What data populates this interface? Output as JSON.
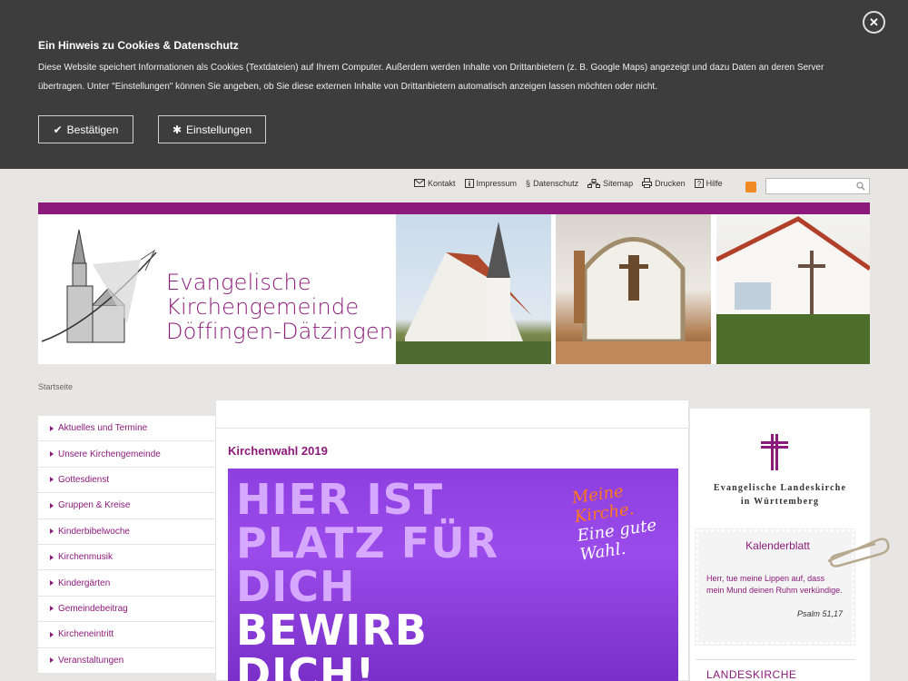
{
  "cookie": {
    "title": "Ein Hinweis zu Cookies & Datenschutz",
    "text": "Diese Website speichert Informationen als Cookies (Textdateien) auf Ihrem Computer. Außerdem werden Inhalte von Drittanbietern (z. B. Google Maps) angezeigt und dazu Daten an deren Server übertragen. Unter \"Einstellungen\" können Sie angeben, ob Sie diese externen Inhalte von Drittanbietern automatisch anzeigen lassen möchten oder nicht.",
    "confirm_label": "Bestätigen",
    "settings_label": "Einstellungen"
  },
  "topnav": [
    "Kontakt",
    "Impressum",
    "Datenschutz",
    "Sitemap",
    "Drucken",
    "Hilfe"
  ],
  "search": {
    "placeholder": ""
  },
  "header": {
    "title_lines": [
      "Evangelische",
      "Kirchengemeinde",
      "Döffingen-Dätzingen"
    ],
    "accent": "#8b1a7a"
  },
  "breadcrumb": "Startseite",
  "leftnav": [
    "Aktuelles und Termine",
    "Unsere Kirchengemeinde",
    "Gottesdienst",
    "Gruppen & Kreise",
    "Kinderbibelwoche",
    "Kirchenmusik",
    "Kindergärten",
    "Gemeindebeitrag",
    "Kircheneintritt",
    "Veranstaltungen"
  ],
  "main": {
    "heading": "Kirchenwahl 2019",
    "banner_lines": [
      "HIER IST",
      "PLATZ FÜR",
      "DICH",
      "BEWIRB",
      "DICH!"
    ],
    "banner_slogan": [
      "Meine",
      "Kirche.",
      "Eine gute",
      "Wahl."
    ],
    "banner_color": "#9a4bea"
  },
  "sidebar": {
    "landeskirche": [
      "Evangelische Landeskirche",
      "in Württemberg"
    ],
    "kalender_title": "Kalenderblatt",
    "kalender_text": "Herr, tue meine Lippen auf, dass mein Mund deinen Ruhm verkündige.",
    "kalender_ref": "Psalm 51,17",
    "bottom_heading": "LANDESKIRCHE"
  }
}
